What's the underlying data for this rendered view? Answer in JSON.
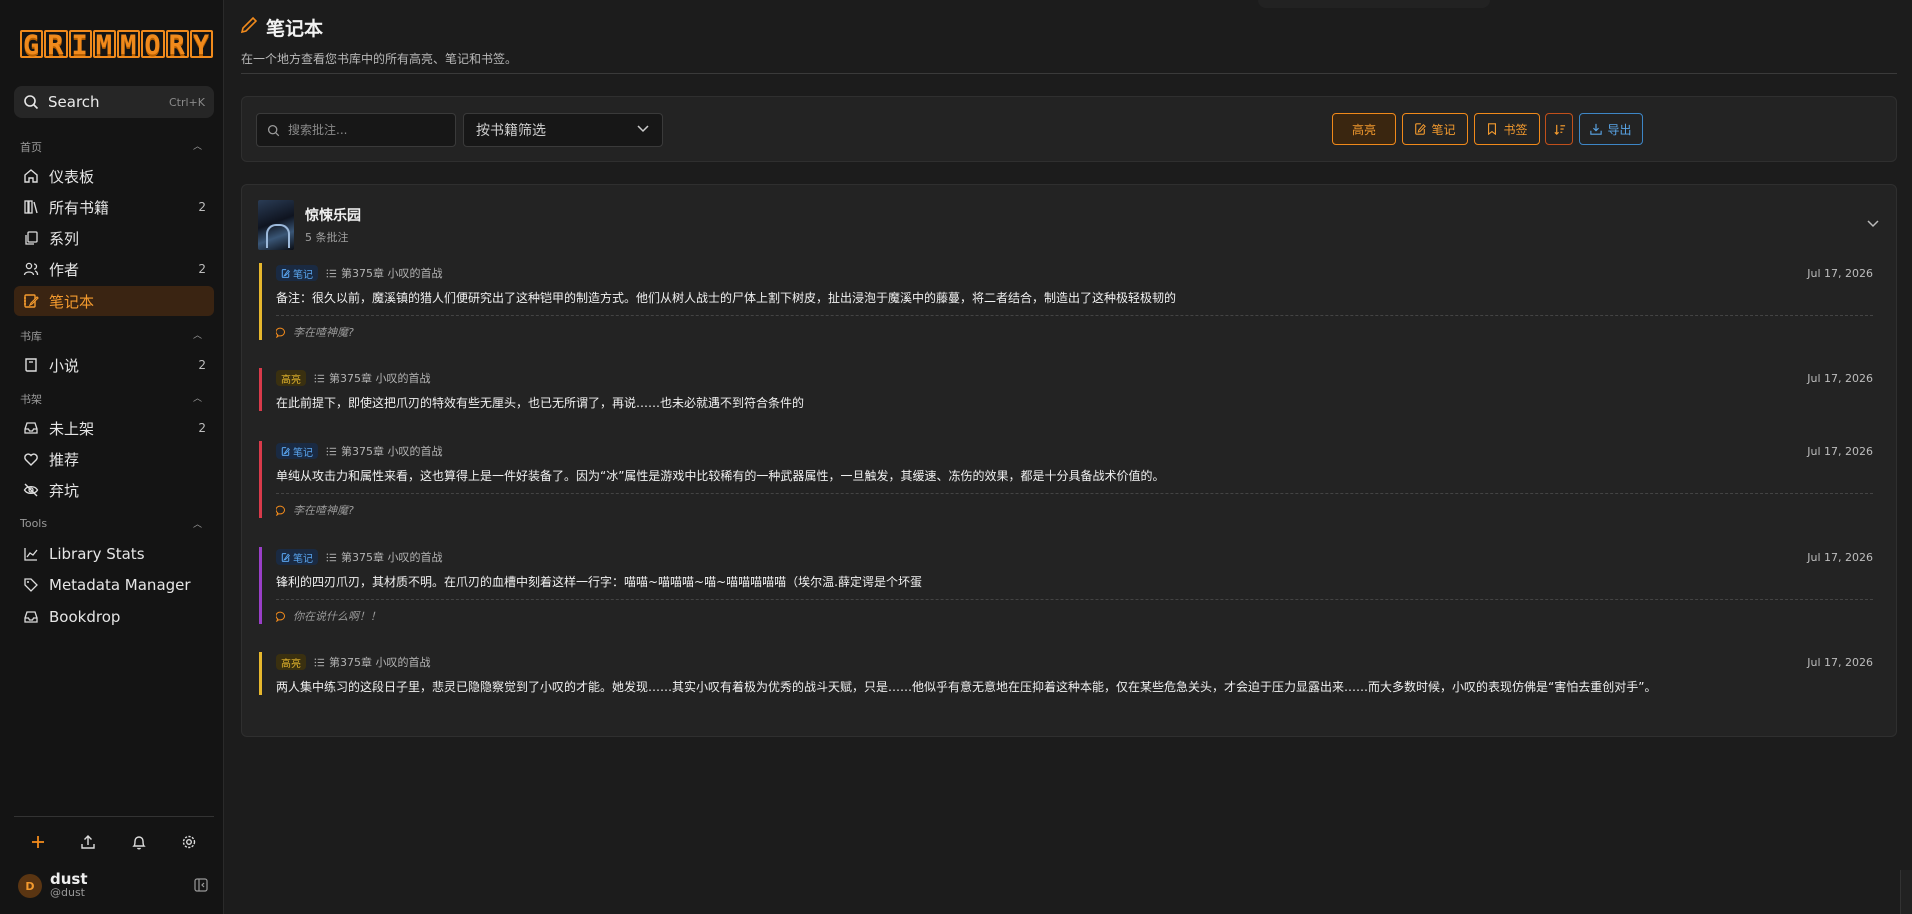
{
  "app": {
    "logo_text": "GRIMMORY"
  },
  "search": {
    "label": "Search",
    "shortcut": "Ctrl+K"
  },
  "sidebar": {
    "sections": [
      {
        "title": "首页",
        "items": [
          {
            "label": "仪表板",
            "count": ""
          },
          {
            "label": "所有书籍",
            "count": "2"
          },
          {
            "label": "系列",
            "count": ""
          },
          {
            "label": "作者",
            "count": "2"
          },
          {
            "label": "笔记本",
            "count": ""
          }
        ]
      },
      {
        "title": "书库",
        "items": [
          {
            "label": "小说",
            "count": "2"
          }
        ]
      },
      {
        "title": "书架",
        "items": [
          {
            "label": "未上架",
            "count": "2"
          },
          {
            "label": "推荐",
            "count": ""
          },
          {
            "label": "弃坑",
            "count": ""
          }
        ]
      },
      {
        "title": "Tools",
        "items": [
          {
            "label": "Library Stats",
            "count": ""
          },
          {
            "label": "Metadata Manager",
            "count": ""
          },
          {
            "label": "Bookdrop",
            "count": ""
          }
        ]
      }
    ],
    "active": "笔记本"
  },
  "user": {
    "initial": "D",
    "name": "dust",
    "handle": "@dust"
  },
  "page": {
    "title": "笔记本",
    "subtitle": "在一个地方查看您书库中的所有高亮、笔记和书签。"
  },
  "toolbar": {
    "search_placeholder": "搜索批注...",
    "book_filter": "按书籍筛选",
    "filters": {
      "highlight": "高亮",
      "note": "笔记",
      "bookmark": "书签",
      "export": "导出"
    }
  },
  "book": {
    "title": "惊悚乐园",
    "count_text": "5 条批注"
  },
  "annotations": [
    {
      "type": "笔记",
      "chapter": "第375章 小叹的首战",
      "date": "Jul 17, 2026",
      "text": "备注：很久以前，魔溪镇的猎人们便研究出了这种铠甲的制造方式。他们从树人战士的尸体上割下树皮，扯出浸泡于魔溪中的藤蔓，将二者结合，制造出了这种极轻极韧的",
      "comment": "李在喳神魔?",
      "color": "#e6b72d"
    },
    {
      "type": "高亮",
      "chapter": "第375章 小叹的首战",
      "date": "Jul 17, 2026",
      "text": "在此前提下，即使这把爪刃的特效有些无厘头，也已无所谓了，再说……也未必就遇不到符合条件的",
      "comment": "",
      "color": "#d83a4a"
    },
    {
      "type": "笔记",
      "chapter": "第375章 小叹的首战",
      "date": "Jul 17, 2026",
      "text": "单纯从攻击力和属性来看，这也算得上是一件好装备了。因为“冰”属性是游戏中比较稀有的一种武器属性，一旦触发，其缓速、冻伤的效果，都是十分具备战术价值的。",
      "comment": "李在喳神魔?",
      "color": "#d83a4a"
    },
    {
      "type": "笔记",
      "chapter": "第375章 小叹的首战",
      "date": "Jul 17, 2026",
      "text": "锋利的四刃爪刃，其材质不明。在爪刃的血槽中刻着这样一行字：喵喵~喵喵喵~喵~喵喵喵喵喵（埃尔温.薛定谔是个坏蛋",
      "comment": "你在说什么啊！！",
      "color": "#9a3fc8"
    },
    {
      "type": "高亮",
      "chapter": "第375章 小叹的首战",
      "date": "Jul 17, 2026",
      "text": "两人集中练习的这段日子里，悲灵已隐隐察觉到了小叹的才能。她发现……其实小叹有着极为优秀的战斗天赋，只是……他似乎有意无意地在压抑着这种本能，仅在某些危急关头，才会迫于压力显露出来……而大多数时候，小叹的表现仿佛是“害怕去重创对手”。",
      "comment": "",
      "color": "#e6b72d"
    }
  ]
}
